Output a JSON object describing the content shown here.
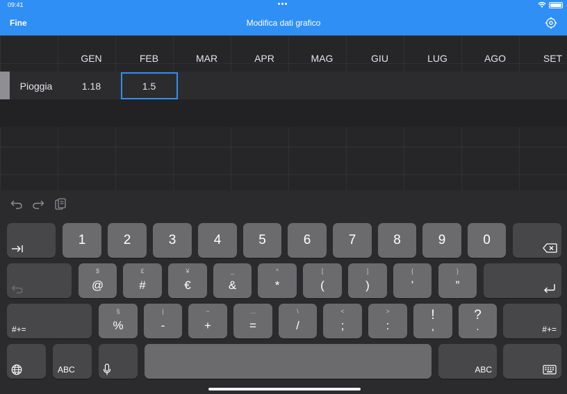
{
  "status": {
    "time": "09:41"
  },
  "nav": {
    "done_label": "Fine",
    "title": "Modifica dati grafico"
  },
  "grid": {
    "columns": [
      "GEN",
      "FEB",
      "MAR",
      "APR",
      "MAG",
      "GIU",
      "LUG",
      "AGO",
      "SET"
    ],
    "rows": [
      {
        "label": "Pioggia",
        "values": [
          "1.18",
          "1.5"
        ]
      }
    ],
    "selected_cell": "FEB"
  },
  "keyboard": {
    "row1": [
      "1",
      "2",
      "3",
      "4",
      "5",
      "6",
      "7",
      "8",
      "9",
      "0"
    ],
    "row2": [
      {
        "main": "@",
        "sub": "$"
      },
      {
        "main": "#",
        "sub": "£"
      },
      {
        "main": "€",
        "sub": "¥"
      },
      {
        "main": "&",
        "sub": "_"
      },
      {
        "main": "*",
        "sub": "^"
      },
      {
        "main": "(",
        "sub": "["
      },
      {
        "main": ")",
        "sub": "]"
      },
      {
        "main": "’",
        "sub": "{"
      },
      {
        "main": "”",
        "sub": "}"
      }
    ],
    "row3": [
      {
        "main": "%",
        "sub": "§"
      },
      {
        "main": "-",
        "sub": "|"
      },
      {
        "main": "+",
        "sub": "~"
      },
      {
        "main": "=",
        "sub": "…"
      },
      {
        "main": "/",
        "sub": "\\"
      },
      {
        "main": ";",
        "sub": "<"
      },
      {
        "main": ":",
        "sub": ">"
      },
      {
        "main": "!",
        "sub": "",
        "extra": ","
      },
      {
        "main": "?",
        "sub": "",
        "extra": "."
      }
    ],
    "symbols_label": "#+=",
    "abc_label": "ABC"
  }
}
